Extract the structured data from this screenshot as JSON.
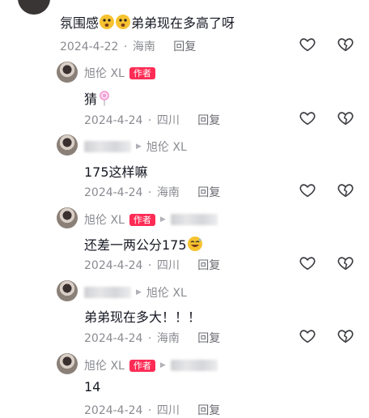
{
  "comments": [
    {
      "text": "氛围感",
      "text_after": "弟弟现在多高了呀",
      "emojis": [
        "astonished-face-emoji",
        "astonished-face-emoji"
      ],
      "date": "2024-4-22",
      "location": "海南",
      "reply": "回复"
    },
    {
      "name": "旭伦 XL",
      "badge": "作者",
      "text": "猜",
      "emoji": "lollipop-emoji",
      "date": "2024-4-24",
      "location": "四川",
      "reply": "回复"
    },
    {
      "reply_to": "旭伦 XL",
      "text": "175这样嘛",
      "date": "2024-4-24",
      "location": "海南",
      "reply": "回复"
    },
    {
      "name": "旭伦 XL",
      "badge": "作者",
      "text": "还差一两公分175",
      "emoji": "grinning-sweat-emoji",
      "date": "2024-4-24",
      "location": "四川",
      "reply": "回复"
    },
    {
      "reply_to": "旭伦 XL",
      "text": "弟弟现在多大！！！",
      "date": "2024-4-24",
      "location": "海南",
      "reply": "回复"
    },
    {
      "name": "旭伦 XL",
      "badge": "作者",
      "text": "14",
      "date": "2024-4-24",
      "location": "四川",
      "reply": "回复"
    }
  ],
  "separator": "·",
  "icons": {
    "like": "heart-outline-icon",
    "dislike": "broken-heart-icon",
    "arrow": "triangle-right-icon"
  },
  "colors": {
    "badge": "#fe2c55",
    "secondary_text": "#8a8b91",
    "primary_text": "#161823"
  }
}
